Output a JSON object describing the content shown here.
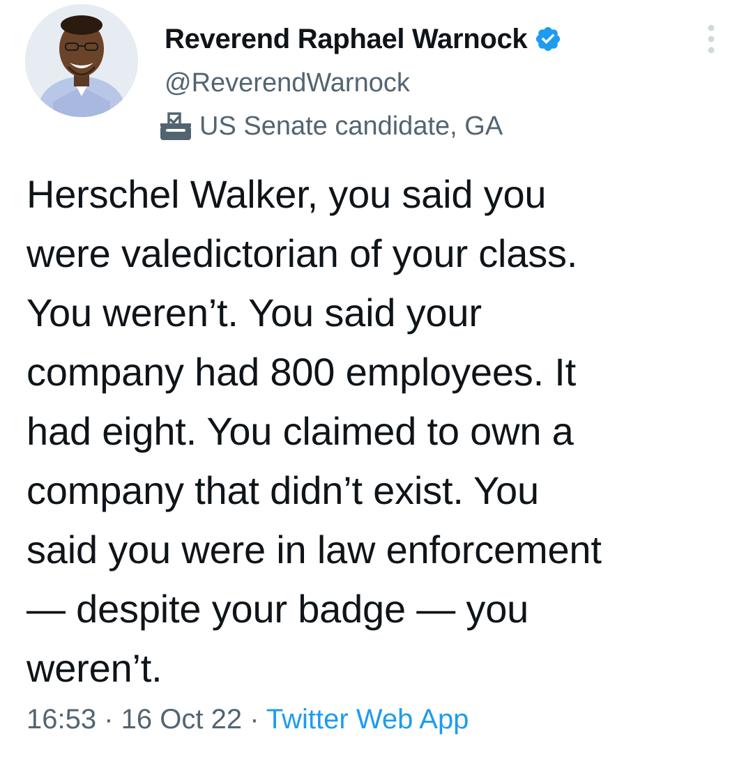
{
  "author": {
    "display_name": "Reverend Raphael Warnock",
    "handle": "@ReverendWarnock",
    "label": "US Senate candidate, GA",
    "verified": true,
    "avatar_icon": "profile-photo-avatar",
    "verified_icon": "verified-badge-icon",
    "label_icon": "ballot-box-icon",
    "more_icon": "more-options-icon"
  },
  "tweet": {
    "lines": [
      "Herschel Walker, you said you",
      "were valedictorian of your class.",
      "You weren’t. You said your",
      "company had 800 employees. It",
      "had eight. You claimed to own a",
      "company that didn’t exist. You",
      "said you were in law enforcement",
      "— despite your badge — you",
      "weren’t."
    ]
  },
  "meta": {
    "time": "16:53",
    "separator1": " · ",
    "date": "16 Oct 22",
    "separator2": " · ",
    "source": "Twitter Web App"
  },
  "colors": {
    "text_primary": "#0f1419",
    "text_secondary": "#536471",
    "accent": "#1d9bf0"
  }
}
